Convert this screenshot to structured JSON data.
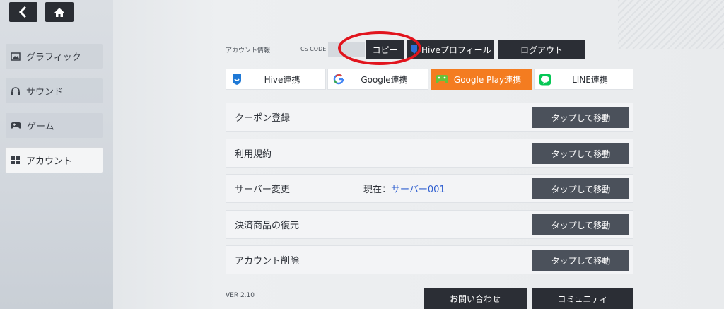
{
  "nav": {
    "back_icon": "chevron-left-icon",
    "home_icon": "home-icon"
  },
  "sidebar": {
    "items": [
      {
        "label": "グラフィック",
        "icon": "image-icon",
        "active": false
      },
      {
        "label": "サウンド",
        "icon": "headphones-icon",
        "active": false
      },
      {
        "label": "ゲーム",
        "icon": "gamepad-icon",
        "active": false
      },
      {
        "label": "アカウント",
        "icon": "account-icon",
        "active": true
      }
    ]
  },
  "account": {
    "info_label": "アカウント情報",
    "cs_code_label": "CS CODE :",
    "copy_label": "コピー",
    "hive_profile_label": "Hiveプロフィール",
    "logout_label": "ログアウト"
  },
  "links": [
    {
      "label": "Hive連携",
      "icon": "hive-shield-icon"
    },
    {
      "label": "Google連携",
      "icon": "google-icon"
    },
    {
      "label": "Google Play連携",
      "icon": "google-play-games-icon"
    },
    {
      "label": "LINE連携",
      "icon": "line-icon"
    }
  ],
  "menu": {
    "rows": [
      {
        "label": "クーポン登録",
        "action": "タップして移動"
      },
      {
        "label": "利用規約",
        "action": "タップして移動"
      },
      {
        "label": "サーバー変更",
        "action": "タップして移動",
        "current_label": "現在：",
        "current_value": "サーバー001"
      },
      {
        "label": "決済商品の復元",
        "action": "タップして移動"
      },
      {
        "label": "アカウント削除",
        "action": "タップして移動"
      }
    ]
  },
  "footer": {
    "version": "VER 2.10",
    "contact_label": "お問い合わせ",
    "community_label": "コミュニティ"
  },
  "colors": {
    "accent_orange": "#f47c20",
    "dark_button": "#2b2e35",
    "action_button": "#4b515b",
    "highlight_ring": "#e1141d",
    "server_text": "#2f5fd0"
  }
}
